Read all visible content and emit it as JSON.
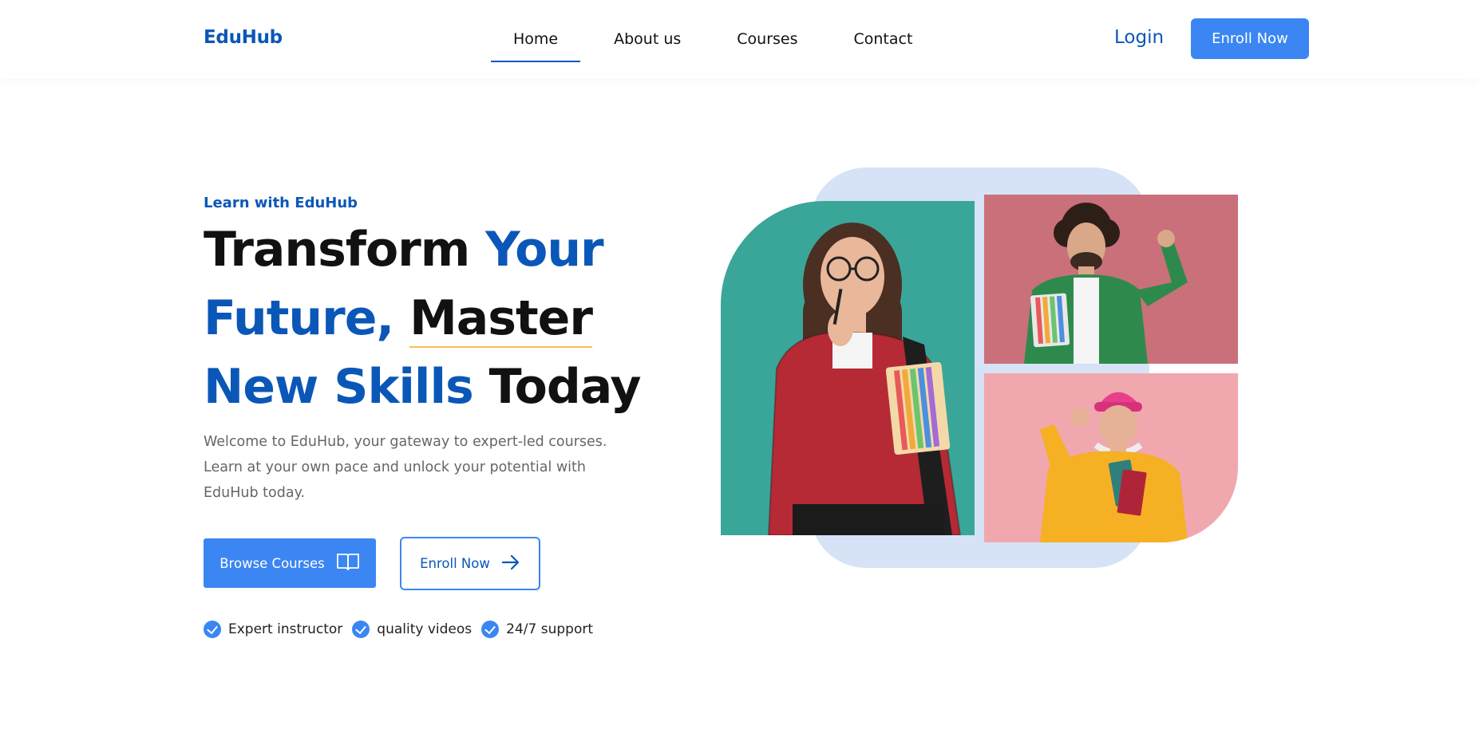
{
  "header": {
    "logo": "EduHub",
    "nav": [
      "Home",
      "About us",
      "Courses",
      "Contact"
    ],
    "active_nav": "Home",
    "login_label": "Login",
    "enroll_label": "Enroll Now"
  },
  "hero": {
    "eyebrow": "Learn with EduHub",
    "headline": {
      "w1": "Transform",
      "w2": "Your",
      "w3": "Future,",
      "w4": "Master",
      "w5": "New Skills",
      "w6": "Today"
    },
    "description": "Welcome to EduHub, your gateway to expert-led courses. Learn at your own pace and unlock your potential with EduHub today.",
    "browse_label": "Browse Courses",
    "browse_icon": "book-open-icon",
    "enroll_label": "Enroll Now",
    "enroll_icon": "arrow-right-icon",
    "features": [
      "Expert instructor",
      "quality videos",
      "24/7 support"
    ]
  },
  "colors": {
    "brand": "#0b57b8",
    "button": "#3b86f2",
    "shape_bg": "#d6e2f6",
    "photo_main_bg": "#3aa69a",
    "photo_top_bg": "#c9707a",
    "photo_bottom_bg": "#f0a8ae"
  }
}
